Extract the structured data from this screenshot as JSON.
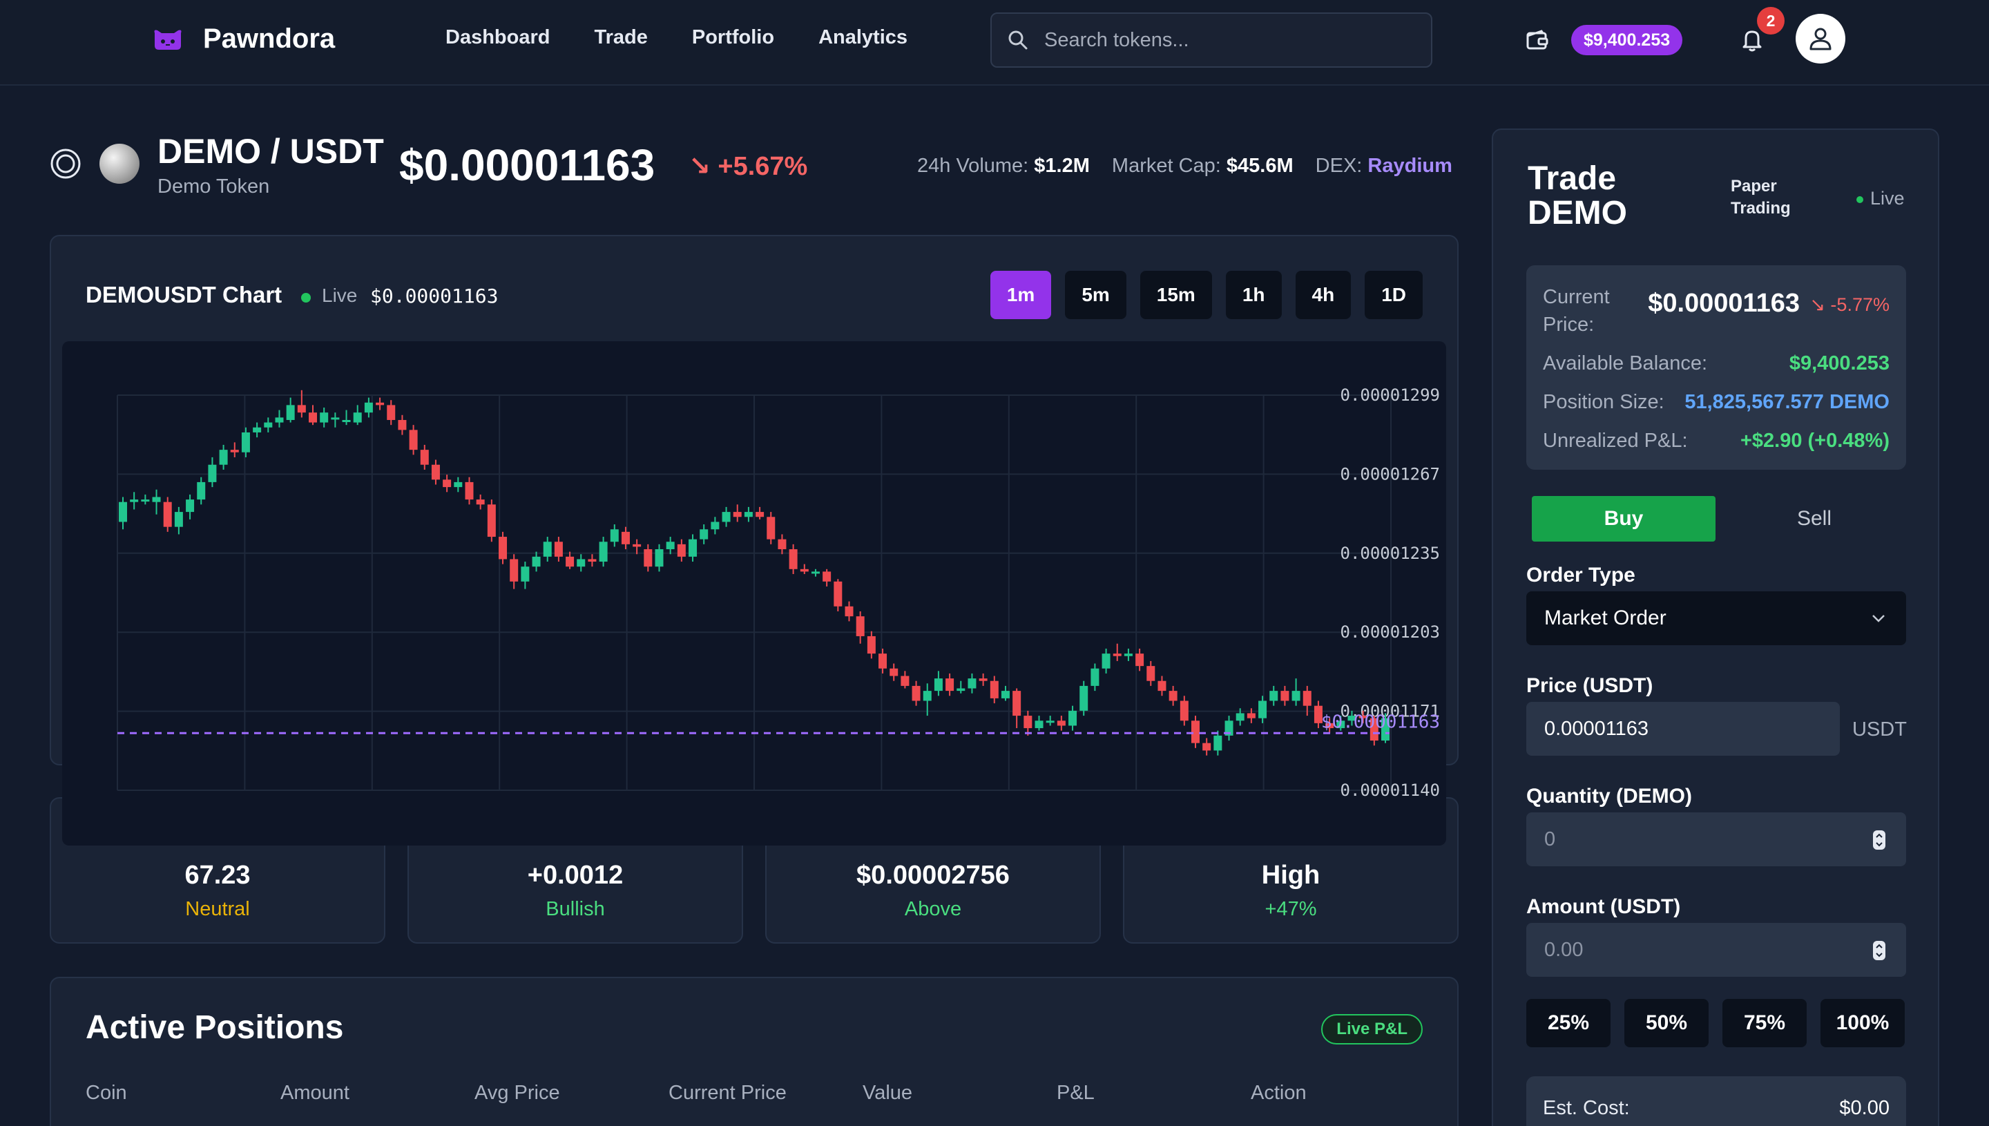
{
  "app": {
    "brand": "Pawndora",
    "nav": [
      "Dashboard",
      "Trade",
      "Portfolio",
      "Analytics"
    ],
    "search_placeholder": "Search tokens...",
    "balance": "$9,400.253",
    "notifications": "2",
    "colors": {
      "accent": "#9333ea",
      "up": "#22c55e",
      "down": "#ef4444",
      "bg": "#131b2c"
    }
  },
  "token": {
    "pair": "DEMO / USDT",
    "name": "Demo Token",
    "price": "$0.00001163",
    "change": "↘ +5.67%",
    "volume_label": "24h Volume:",
    "volume": "$1.2M",
    "mcap_label": "Market Cap:",
    "mcap": "$45.6M",
    "dex_label": "DEX:",
    "dex": "Raydium"
  },
  "chart": {
    "title": "DEMOUSDT Chart",
    "live_label": "Live",
    "live_price": "$0.00001163",
    "timeframes": [
      "1m",
      "5m",
      "15m",
      "1h",
      "4h",
      "1D"
    ],
    "active_timeframe": "1m",
    "current_price_label": "$0.00001163"
  },
  "chart_data": {
    "type": "candlestick",
    "y_ticks": [
      "0.00001299",
      "0.00001267",
      "0.00001235",
      "0.00001203",
      "0.00001171",
      "0.00001140"
    ],
    "ylim": [
      1.14e-05,
      1.299e-05
    ],
    "current_price": 1.163e-05,
    "candles": [
      [
        1.248,
        1.256,
        1.258,
        1.245
      ],
      [
        1.256,
        1.257,
        1.26,
        1.253
      ],
      [
        1.257,
        1.257,
        1.259,
        1.255
      ],
      [
        1.256,
        1.258,
        1.261,
        1.251
      ],
      [
        1.256,
        1.246,
        1.258,
        1.244
      ],
      [
        1.246,
        1.252,
        1.254,
        1.243
      ],
      [
        1.252,
        1.257,
        1.259,
        1.249
      ],
      [
        1.257,
        1.264,
        1.266,
        1.255
      ],
      [
        1.264,
        1.271,
        1.274,
        1.262
      ],
      [
        1.271,
        1.277,
        1.279,
        1.269
      ],
      [
        1.277,
        1.276,
        1.28,
        1.274
      ],
      [
        1.276,
        1.284,
        1.286,
        1.274
      ],
      [
        1.284,
        1.286,
        1.288,
        1.282
      ],
      [
        1.286,
        1.288,
        1.29,
        1.284
      ],
      [
        1.288,
        1.29,
        1.293,
        1.286
      ],
      [
        1.289,
        1.295,
        1.298,
        1.288
      ],
      [
        1.295,
        1.292,
        1.301,
        1.29
      ],
      [
        1.292,
        1.288,
        1.295,
        1.287
      ],
      [
        1.288,
        1.292,
        1.294,
        1.286
      ],
      [
        1.29,
        1.29,
        1.292,
        1.286
      ],
      [
        1.289,
        1.289,
        1.293,
        1.287
      ],
      [
        1.288,
        1.292,
        1.295,
        1.287
      ],
      [
        1.292,
        1.296,
        1.298,
        1.29
      ],
      [
        1.296,
        1.295,
        1.298,
        1.293
      ],
      [
        1.295,
        1.289,
        1.297,
        1.287
      ],
      [
        1.289,
        1.285,
        1.291,
        1.283
      ],
      [
        1.285,
        1.277,
        1.287,
        1.275
      ],
      [
        1.277,
        1.271,
        1.279,
        1.269
      ],
      [
        1.271,
        1.265,
        1.273,
        1.263
      ],
      [
        1.265,
        1.262,
        1.267,
        1.26
      ],
      [
        1.262,
        1.264,
        1.266,
        1.26
      ],
      [
        1.264,
        1.257,
        1.266,
        1.255
      ],
      [
        1.257,
        1.255,
        1.259,
        1.253
      ],
      [
        1.255,
        1.242,
        1.257,
        1.24
      ],
      [
        1.242,
        1.233,
        1.244,
        1.231
      ],
      [
        1.233,
        1.224,
        1.235,
        1.221
      ],
      [
        1.224,
        1.23,
        1.232,
        1.221
      ],
      [
        1.23,
        1.234,
        1.236,
        1.228
      ],
      [
        1.234,
        1.24,
        1.242,
        1.232
      ],
      [
        1.24,
        1.234,
        1.242,
        1.232
      ],
      [
        1.234,
        1.23,
        1.236,
        1.229
      ],
      [
        1.23,
        1.233,
        1.235,
        1.228
      ],
      [
        1.233,
        1.232,
        1.235,
        1.23
      ],
      [
        1.232,
        1.24,
        1.242,
        1.23
      ],
      [
        1.24,
        1.245,
        1.247,
        1.238
      ],
      [
        1.244,
        1.239,
        1.246,
        1.237
      ],
      [
        1.239,
        1.238,
        1.241,
        1.235
      ],
      [
        1.237,
        1.23,
        1.239,
        1.228
      ],
      [
        1.23,
        1.237,
        1.239,
        1.228
      ],
      [
        1.237,
        1.24,
        1.242,
        1.235
      ],
      [
        1.239,
        1.234,
        1.241,
        1.232
      ],
      [
        1.234,
        1.241,
        1.243,
        1.232
      ],
      [
        1.241,
        1.245,
        1.247,
        1.239
      ],
      [
        1.245,
        1.248,
        1.25,
        1.243
      ],
      [
        1.248,
        1.252,
        1.254,
        1.246
      ],
      [
        1.252,
        1.25,
        1.255,
        1.248
      ],
      [
        1.25,
        1.252,
        1.254,
        1.248
      ],
      [
        1.252,
        1.25,
        1.254,
        1.249
      ],
      [
        1.25,
        1.241,
        1.252,
        1.239
      ],
      [
        1.241,
        1.237,
        1.243,
        1.235
      ],
      [
        1.237,
        1.229,
        1.239,
        1.227
      ],
      [
        1.229,
        1.228,
        1.231,
        1.227
      ],
      [
        1.228,
        1.228,
        1.229,
        1.226
      ],
      [
        1.228,
        1.224,
        1.229,
        1.222
      ],
      [
        1.224,
        1.214,
        1.225,
        1.212
      ],
      [
        1.214,
        1.21,
        1.216,
        1.208
      ],
      [
        1.21,
        1.202,
        1.212,
        1.199
      ],
      [
        1.202,
        1.195,
        1.204,
        1.193
      ],
      [
        1.195,
        1.189,
        1.197,
        1.187
      ],
      [
        1.189,
        1.186,
        1.191,
        1.184
      ],
      [
        1.186,
        1.182,
        1.188,
        1.181
      ],
      [
        1.182,
        1.176,
        1.184,
        1.174
      ],
      [
        1.176,
        1.18,
        1.183,
        1.17
      ],
      [
        1.18,
        1.185,
        1.188,
        1.178
      ],
      [
        1.185,
        1.18,
        1.187,
        1.178
      ],
      [
        1.18,
        1.181,
        1.184,
        1.179
      ],
      [
        1.181,
        1.185,
        1.187,
        1.179
      ],
      [
        1.185,
        1.184,
        1.187,
        1.182
      ],
      [
        1.184,
        1.177,
        1.186,
        1.175
      ],
      [
        1.177,
        1.18,
        1.182,
        1.176
      ],
      [
        1.18,
        1.17,
        1.181,
        1.165
      ],
      [
        1.17,
        1.165,
        1.172,
        1.162
      ],
      [
        1.165,
        1.168,
        1.17,
        1.164
      ],
      [
        1.168,
        1.168,
        1.17,
        1.166
      ],
      [
        1.168,
        1.166,
        1.17,
        1.164
      ],
      [
        1.166,
        1.172,
        1.174,
        1.164
      ],
      [
        1.172,
        1.182,
        1.184,
        1.17
      ],
      [
        1.182,
        1.189,
        1.191,
        1.18
      ],
      [
        1.189,
        1.195,
        1.197,
        1.187
      ],
      [
        1.195,
        1.194,
        1.199,
        1.192
      ],
      [
        1.194,
        1.195,
        1.197,
        1.192
      ],
      [
        1.195,
        1.19,
        1.197,
        1.188
      ],
      [
        1.19,
        1.184,
        1.192,
        1.182
      ],
      [
        1.184,
        1.18,
        1.186,
        1.178
      ],
      [
        1.18,
        1.176,
        1.182,
        1.174
      ],
      [
        1.176,
        1.168,
        1.178,
        1.166
      ],
      [
        1.168,
        1.159,
        1.17,
        1.157
      ],
      [
        1.159,
        1.156,
        1.161,
        1.154
      ],
      [
        1.156,
        1.162,
        1.164,
        1.154
      ],
      [
        1.162,
        1.168,
        1.17,
        1.16
      ],
      [
        1.168,
        1.171,
        1.173,
        1.166
      ],
      [
        1.171,
        1.169,
        1.173,
        1.167
      ],
      [
        1.169,
        1.176,
        1.178,
        1.167
      ],
      [
        1.176,
        1.18,
        1.182,
        1.174
      ],
      [
        1.18,
        1.176,
        1.182,
        1.174
      ],
      [
        1.176,
        1.18,
        1.185,
        1.174
      ],
      [
        1.18,
        1.174,
        1.182,
        1.17
      ],
      [
        1.174,
        1.167,
        1.176,
        1.165
      ],
      [
        1.167,
        1.165,
        1.169,
        1.163
      ],
      [
        1.165,
        1.168,
        1.17,
        1.164
      ],
      [
        1.168,
        1.17,
        1.172,
        1.166
      ],
      [
        1.17,
        1.169,
        1.172,
        1.167
      ],
      [
        1.169,
        1.16,
        1.17,
        1.158
      ],
      [
        1.16,
        1.169,
        1.171,
        1.159
      ]
    ],
    "candle_units": "1e-5 USDT (open, close, high, low)"
  },
  "indicators": [
    {
      "value": "67.23",
      "label": "Neutral",
      "color": "#eab308"
    },
    {
      "value": "+0.0012",
      "label": "Bullish",
      "color": "#4ade80"
    },
    {
      "value": "$0.00002756",
      "label": "Above",
      "color": "#4ade80"
    },
    {
      "value": "High",
      "label": "+47%",
      "color": "#4ade80"
    }
  ],
  "positions": {
    "title": "Active Positions",
    "badge": "Live P&L",
    "columns": [
      "Coin",
      "Amount",
      "Avg Price",
      "Current Price",
      "Value",
      "P&L",
      "Action"
    ]
  },
  "trade": {
    "title": "Trade DEMO",
    "mode": "Paper Trading",
    "live": "Live",
    "current_price_label": "Current Price:",
    "current_price": "$0.00001163",
    "current_change": "↘ -5.77%",
    "available_label": "Available Balance:",
    "available": "$9,400.253",
    "position_label": "Position Size:",
    "position": "51,825,567.577 DEMO",
    "pnl_label": "Unrealized P&L:",
    "pnl": "+$2.90 (+0.48%)",
    "buy": "Buy",
    "sell": "Sell",
    "order_type_label": "Order Type",
    "order_type": "Market Order",
    "price_label": "Price (USDT)",
    "price_value": "0.00001163",
    "price_unit": "USDT",
    "qty_label": "Quantity (DEMO)",
    "qty_value": "0",
    "amount_label": "Amount (USDT)",
    "amount_value": "0.00",
    "pcts": [
      "25%",
      "50%",
      "75%",
      "100%"
    ],
    "cost_label": "Est. Cost:",
    "cost_value": "$0.00"
  }
}
